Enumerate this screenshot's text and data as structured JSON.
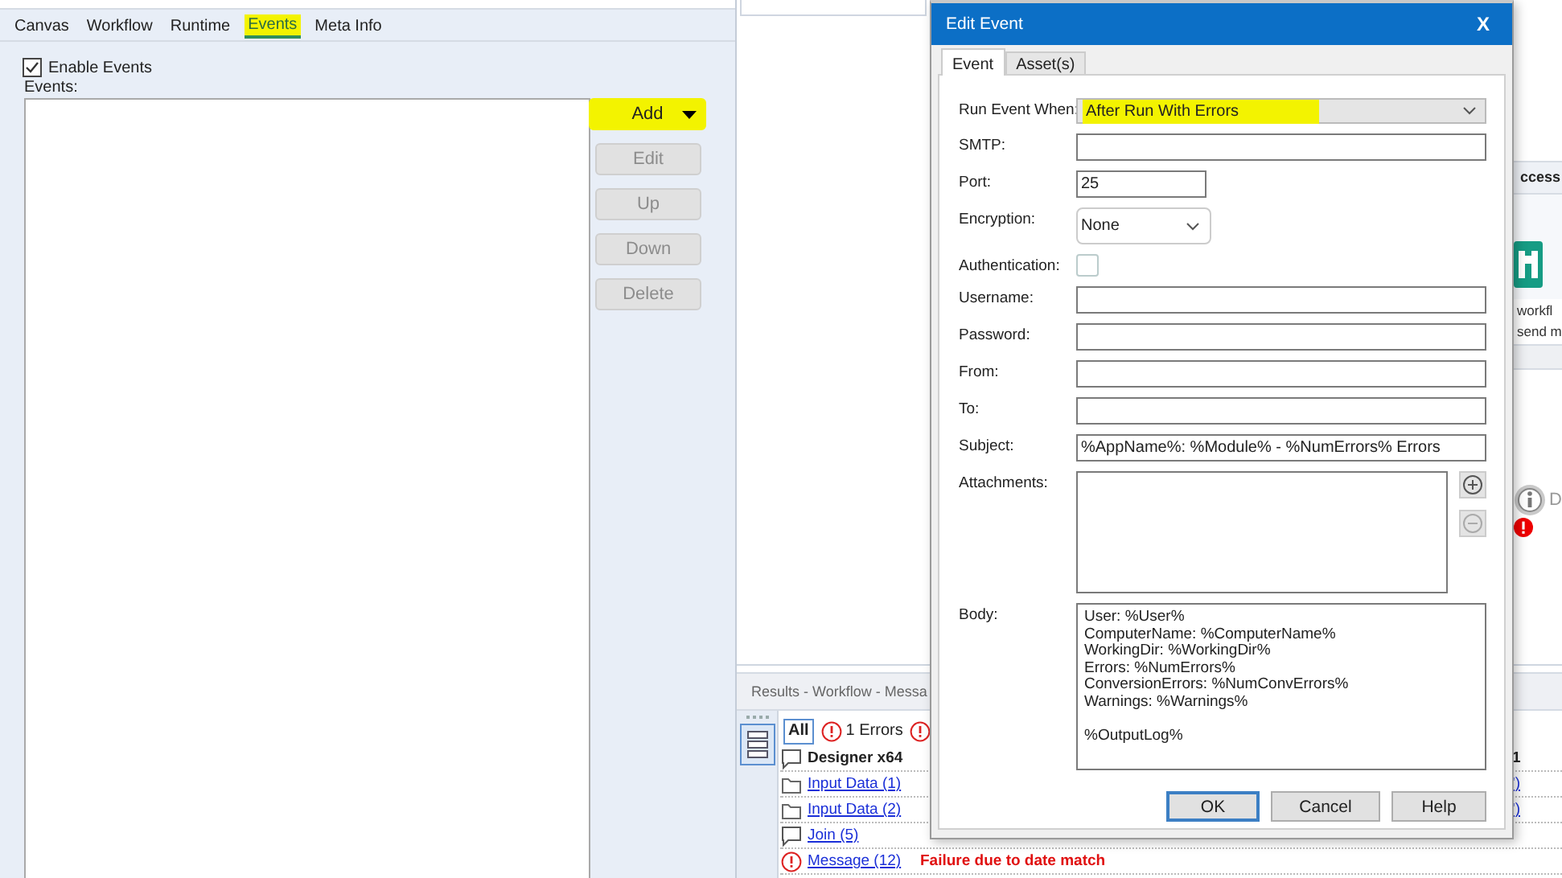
{
  "settings_panel": {
    "tabs": [
      {
        "label": "Canvas",
        "selected": false,
        "highlighted": false
      },
      {
        "label": "Workflow",
        "selected": false,
        "highlighted": false
      },
      {
        "label": "Runtime",
        "selected": false,
        "highlighted": false
      },
      {
        "label": "Events",
        "selected": true,
        "highlighted": true
      },
      {
        "label": "Meta Info",
        "selected": false,
        "highlighted": false
      }
    ],
    "enable_events": {
      "label": "Enable Events",
      "checked": true
    },
    "events_label": "Events:",
    "buttons": [
      {
        "label": "Add",
        "disabled": false,
        "highlighted": true,
        "dropdown": true
      },
      {
        "label": "Edit",
        "disabled": true,
        "highlighted": false,
        "dropdown": false
      },
      {
        "label": "Up",
        "disabled": true,
        "highlighted": false,
        "dropdown": false
      },
      {
        "label": "Down",
        "disabled": true,
        "highlighted": false,
        "dropdown": false
      },
      {
        "label": "Delete",
        "disabled": true,
        "highlighted": false,
        "dropdown": false
      }
    ]
  },
  "tool_palette": {
    "header": "ccess",
    "description": "workfl\nsend m",
    "tool_label": "D"
  },
  "results": {
    "title": "Results - Workflow - Messa",
    "filters": [
      {
        "kind": "all",
        "label": "All",
        "selected": true
      },
      {
        "kind": "errors",
        "label": "1 Errors",
        "selected": false
      }
    ],
    "rows": [
      {
        "kind": "summary",
        "tool": "Designer x64",
        "column_3": "1"
      },
      {
        "kind": "input",
        "tool": "Input Data (1)",
        "column_3": "')"
      },
      {
        "kind": "input",
        "tool": "Input Data (2)",
        "column_3": "')"
      },
      {
        "kind": "tool",
        "tool": "Join (5)"
      },
      {
        "kind": "error",
        "tool": "Message (12)",
        "message": "Failure due to date match"
      }
    ]
  },
  "dialog": {
    "title": "Edit Event",
    "close": "X",
    "tabs": [
      {
        "label": "Event",
        "selected": true
      },
      {
        "label": "Asset(s)",
        "selected": false
      }
    ],
    "fields": [
      {
        "kind": "select",
        "label": "Run Event When:",
        "value": "After Run With Errors",
        "highlighted": true
      },
      {
        "kind": "text",
        "label": "SMTP:"
      },
      {
        "kind": "number",
        "label": "Port:",
        "value": "25"
      },
      {
        "kind": "dropdown",
        "label": "Encryption:",
        "value": "None"
      },
      {
        "kind": "checkbox",
        "label": "Authentication:",
        "checked": false
      },
      {
        "kind": "text",
        "label": "Username:"
      },
      {
        "kind": "text",
        "label": "Password:"
      },
      {
        "kind": "text",
        "label": "From:"
      },
      {
        "kind": "text",
        "label": "To:"
      },
      {
        "kind": "text",
        "label": "Subject:",
        "value": "%AppName%: %Module% - %NumErrors% Errors"
      },
      {
        "kind": "list",
        "label": "Attachments:"
      },
      {
        "kind": "textarea",
        "label": "Body:",
        "value": "User: %User%\nComputerName: %ComputerName%\nWorkingDir: %WorkingDir%\nErrors: %NumErrors%\nConversionErrors: %NumConvErrors%\nWarnings: %Warnings%\n\n%OutputLog%"
      }
    ],
    "buttons": [
      {
        "label": "OK",
        "default": true
      },
      {
        "label": "Cancel",
        "default": false
      },
      {
        "label": "Help",
        "default": false
      }
    ]
  }
}
